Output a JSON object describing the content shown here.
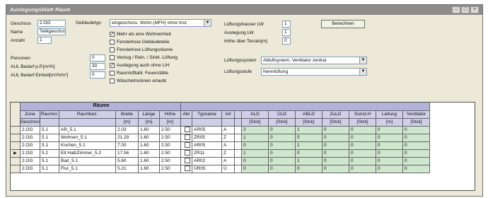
{
  "window": {
    "title": "Auslegungsblatt Raum"
  },
  "form": {
    "geschoss": {
      "label": "Geschoss",
      "value": "2.OG"
    },
    "name": {
      "label": "Name",
      "value": "Teilkgeschoss"
    },
    "anzahl": {
      "label": "Anzahl",
      "value": "1"
    },
    "gebaeudetyp": {
      "label": "Gebäudetyp:",
      "value": "eingeschoss. Wohn.(MFH) ohne Inst."
    },
    "options": [
      {
        "label": "Mehr als eine Wohneinheit",
        "checked": true
      },
      {
        "label": "Fensterlose Gebäudeteile",
        "checked": false
      },
      {
        "label": "Fensterlose Lüftungsräume",
        "checked": false
      },
      {
        "label": "Verzug / Rein. / Sinkt. Lüftung",
        "checked": false
      },
      {
        "label": "Auslegung auch ohne LiH",
        "checked": true
      },
      {
        "label": "Raumlufttahl. Feuerstätte",
        "checked": false
      },
      {
        "label": "Wäschetrocknen erlaubt",
        "checked": false
      }
    ],
    "personen": {
      "label": "Personen",
      "value": "0"
    },
    "ausl_bedarf_p": {
      "label": "AUL Bedarf p.P.[m³/h]",
      "value": "30"
    },
    "ausl_bedarf_ein": {
      "label": "AUL Bedarf Einheit[m³/h/m²]",
      "value": "0"
    },
    "lueftungsmenge": {
      "label": "Lüftungshauser LW",
      "value": "1"
    },
    "auslegung": {
      "label": "Auslegung LW",
      "value": "1"
    },
    "hoehe": {
      "label": "Höhe über Terrain[m]",
      "value": "0"
    },
    "calc_button": "Berechnen",
    "lueftungssystem": {
      "label": "Lüftungssystem",
      "value": "Abluftsystem, Ventilator zentral"
    },
    "lueftungsstufe": {
      "label": "Lüftungsstufe",
      "value": "Nennlüftung"
    }
  },
  "table": {
    "group_header": "Räume",
    "headers": [
      "Zone",
      "Raumnr.",
      "Raumbez.",
      "Breite",
      "Länge",
      "Höhe",
      "Abr",
      "Typname",
      "Art",
      "",
      "ALD",
      "ÜLD",
      "ABLD",
      "ZuLD",
      "Sonst.H",
      "Leitung",
      "Ventilator"
    ],
    "units": [
      "Geschoss",
      "",
      "",
      "[m]",
      "[m]",
      "[m]",
      "",
      "",
      "",
      "",
      "[Stck]",
      "[Stck]",
      "[Stck]",
      "[Stck]",
      "[Stck]",
      "[m]",
      "[Stck]"
    ],
    "rows": [
      {
        "marker": "",
        "cells": [
          "2.OG",
          "5.1",
          "AR_5.1",
          "2.03",
          "1.60",
          "2.50",
          "",
          "AR05",
          "A",
          "",
          "2",
          "0",
          "1",
          "0",
          "0",
          "0",
          "0"
        ]
      },
      {
        "marker": "",
        "cells": [
          "2.OG",
          "5.1",
          "Wohnen_5.1",
          "21.29",
          "1.60",
          "2.50",
          "",
          "ZR05",
          "Z",
          "",
          "1",
          "0",
          "0",
          "0",
          "0",
          "0",
          "0"
        ]
      },
      {
        "marker": "",
        "cells": [
          "2.OG",
          "5.1",
          "Kochen_5.1",
          "7.00",
          "1.60",
          "2.50",
          "",
          "AR05",
          "A",
          "",
          "0",
          "0",
          "1",
          "0",
          "0",
          "0",
          "0"
        ]
      },
      {
        "marker": "▶",
        "cells": [
          "2.OG",
          "5.2",
          "Elt.Hall/Zimmer_5.2",
          "17.56",
          "1.60",
          "2.50",
          "",
          "ZR11",
          "Z",
          "",
          "1",
          "0",
          "0",
          "0",
          "0",
          "0",
          "0"
        ]
      },
      {
        "marker": "",
        "cells": [
          "2.OG",
          "5.1",
          "Bad_5.1",
          "5.60",
          "1.60",
          "2.50",
          "",
          "AR02",
          "A",
          "",
          "0",
          "0",
          "1",
          "0",
          "0",
          "0",
          "0"
        ]
      },
      {
        "marker": "",
        "cells": [
          "2.OG",
          "5.1",
          "Flur_5.1",
          "5.21",
          "1.60",
          "2.50",
          "",
          "ÜR05",
          "Ü",
          "",
          "0",
          "0",
          "0",
          "0",
          "0",
          "0",
          "0"
        ]
      }
    ]
  }
}
